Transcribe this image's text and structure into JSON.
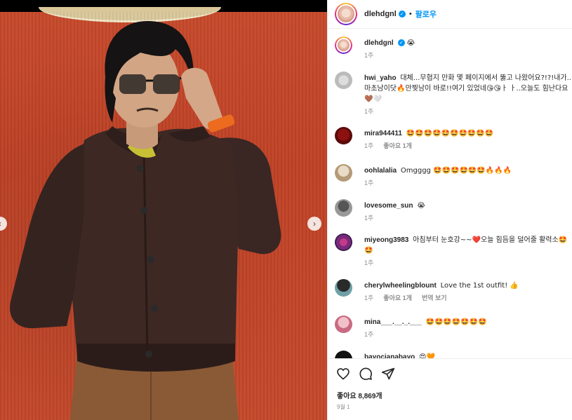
{
  "post": {
    "username": "dlehdgnl",
    "follow_label": "팔로우",
    "separator": "•",
    "caption_emoji": "😭",
    "caption_time": "1주",
    "likes": "좋아요 8,869개",
    "date": "9월 1"
  },
  "comments": [
    {
      "username": "hwi_yaho",
      "text": "대체...무협지 만화 몇 페이지에서 뚫고 나왔어요?!?!내가..마초남이닷🔥만찢남이 바로!!여기 있었네😘😘ㅏ ㅏ..오늘도 힘난다요🤎🤍",
      "time": "1주",
      "likes": "",
      "translate": ""
    },
    {
      "username": "mira944411",
      "text": "🤩🤩🤩🤩🤩🤩🤩🤩🤩🤩",
      "time": "1주",
      "likes": "좋아요 1개",
      "translate": ""
    },
    {
      "username": "oohlalalia",
      "text": "Omgggg 🤩🤩🤩🤩🤩🤩🔥🔥🔥",
      "time": "1주",
      "likes": "",
      "translate": ""
    },
    {
      "username": "lovesome_sun",
      "text": "😭",
      "time": "1주",
      "likes": "",
      "translate": ""
    },
    {
      "username": "miyeong3983",
      "text": "아침부터 눈호강~~❤️오늘 힘듬을 덜어줄 활력소🤩🤩",
      "time": "1주",
      "likes": "",
      "translate": ""
    },
    {
      "username": "cherylwheelingblount",
      "text": "Love the 1st outfit! 👍",
      "time": "1주",
      "likes": "좋아요 1개",
      "translate": "번역 보기"
    },
    {
      "username": "mina___.__._.___",
      "text": "🤩🤩🤩🤩🤩🤩🤩",
      "time": "1주",
      "likes": "",
      "translate": ""
    },
    {
      "username": "bayocjanabayo",
      "text": "😍🧡",
      "time": "",
      "likes": "",
      "translate": ""
    }
  ],
  "icons": {
    "like": "heart-icon",
    "comment": "comment-icon",
    "share": "share-icon",
    "nav_left": "chevron-left-icon",
    "nav_right": "chevron-right-icon",
    "verified": "verified-badge-icon"
  },
  "colors": {
    "accent": "#0095f6",
    "backdrop": "#c4472a"
  }
}
